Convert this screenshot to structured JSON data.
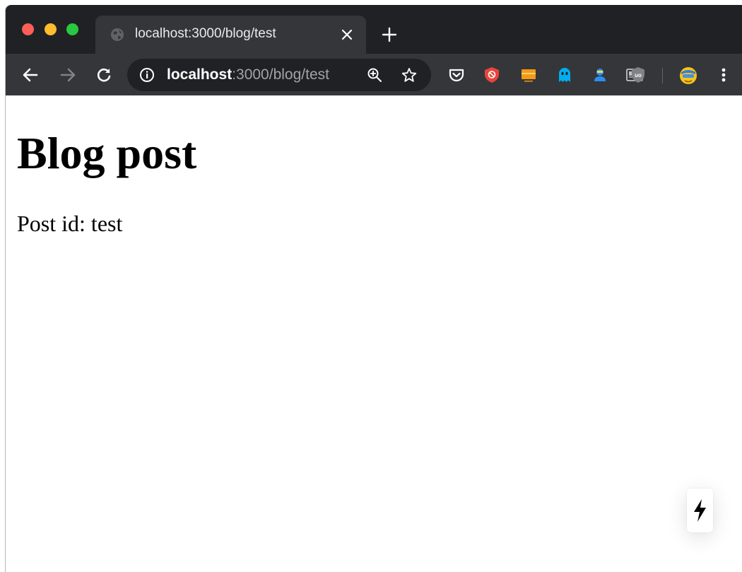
{
  "browser": {
    "tab": {
      "title": "localhost:3000/blog/test"
    },
    "address_bar": {
      "host": "localhost",
      "path": ":3000/blog/test"
    },
    "extensions": [
      "pocket-icon",
      "ad-block-shield-icon",
      "orange-extension-icon",
      "ghostery-icon",
      "blue-person-icon",
      "reader-view-icon",
      "ublock-origin-icon",
      "profile-avatar-icon"
    ]
  },
  "page": {
    "heading": "Blog post",
    "post_id_text": "Post id: test"
  },
  "colors": {
    "tabstrip": "#202124",
    "toolbar": "#35363a",
    "omnibox": "#202124",
    "traffic_red": "#ff5f57",
    "traffic_yellow": "#febc2e",
    "traffic_green": "#28c840"
  }
}
